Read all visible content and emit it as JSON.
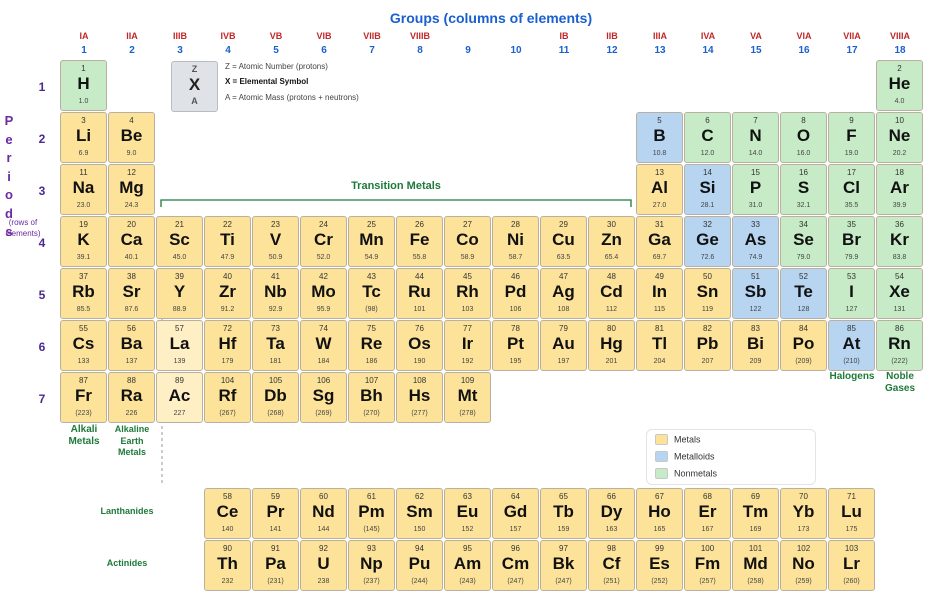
{
  "title": "Groups (columns of elements)",
  "group_labels": [
    "IA",
    "IIA",
    "IIIB",
    "IVB",
    "VB",
    "VIB",
    "VIIB",
    "VIIIB",
    "",
    "",
    "IB",
    "IIB",
    "IIIA",
    "IVA",
    "VA",
    "VIA",
    "VIIA",
    "VIIIA"
  ],
  "group_numbers": [
    "1",
    "2",
    "3",
    "4",
    "5",
    "6",
    "7",
    "8",
    "9",
    "10",
    "11",
    "12",
    "13",
    "14",
    "15",
    "16",
    "17",
    "18"
  ],
  "periods_label": "Periods",
  "periods_note": [
    "(rows of",
    "elements)"
  ],
  "period_numbers": [
    "1",
    "2",
    "3",
    "4",
    "5",
    "6",
    "7"
  ],
  "key": {
    "z": "Z",
    "x": "X",
    "a": "A",
    "lines": [
      "Z = Atomic Number (protons)",
      "X = Elemental Symbol",
      "A = Atomic Mass (protons + neutrons)"
    ]
  },
  "transition_label": "Transition Metals",
  "labels": {
    "alkali": [
      "Alkali",
      "Metals"
    ],
    "alkaline": [
      "Alkaline",
      "Earth",
      "Metals"
    ],
    "halogens": "Halogens",
    "noble": [
      "Noble",
      "Gases"
    ],
    "lanthanides": "Lanthanides",
    "actinides": "Actinides"
  },
  "legend": [
    {
      "label": "Metals",
      "color": "#fde39a"
    },
    {
      "label": "Metalloids",
      "color": "#b7d5f0"
    },
    {
      "label": "Nonmetals",
      "color": "#c6ebc6"
    }
  ],
  "elements": [
    {
      "z": "1",
      "s": "H",
      "m": "1.0",
      "g": 1,
      "p": 1,
      "c": "nonmetal"
    },
    {
      "z": "2",
      "s": "He",
      "m": "4.0",
      "g": 18,
      "p": 1,
      "c": "nonmetal"
    },
    {
      "z": "3",
      "s": "Li",
      "m": "6.9",
      "g": 1,
      "p": 2,
      "c": "metal"
    },
    {
      "z": "4",
      "s": "Be",
      "m": "9.0",
      "g": 2,
      "p": 2,
      "c": "metal"
    },
    {
      "z": "5",
      "s": "B",
      "m": "10.8",
      "g": 13,
      "p": 2,
      "c": "metalloid"
    },
    {
      "z": "6",
      "s": "C",
      "m": "12.0",
      "g": 14,
      "p": 2,
      "c": "nonmetal"
    },
    {
      "z": "7",
      "s": "N",
      "m": "14.0",
      "g": 15,
      "p": 2,
      "c": "nonmetal"
    },
    {
      "z": "8",
      "s": "O",
      "m": "16.0",
      "g": 16,
      "p": 2,
      "c": "nonmetal"
    },
    {
      "z": "9",
      "s": "F",
      "m": "19.0",
      "g": 17,
      "p": 2,
      "c": "nonmetal"
    },
    {
      "z": "10",
      "s": "Ne",
      "m": "20.2",
      "g": 18,
      "p": 2,
      "c": "nonmetal"
    },
    {
      "z": "11",
      "s": "Na",
      "m": "23.0",
      "g": 1,
      "p": 3,
      "c": "metal"
    },
    {
      "z": "12",
      "s": "Mg",
      "m": "24.3",
      "g": 2,
      "p": 3,
      "c": "metal"
    },
    {
      "z": "13",
      "s": "Al",
      "m": "27.0",
      "g": 13,
      "p": 3,
      "c": "metal"
    },
    {
      "z": "14",
      "s": "Si",
      "m": "28.1",
      "g": 14,
      "p": 3,
      "c": "metalloid"
    },
    {
      "z": "15",
      "s": "P",
      "m": "31.0",
      "g": 15,
      "p": 3,
      "c": "nonmetal"
    },
    {
      "z": "16",
      "s": "S",
      "m": "32.1",
      "g": 16,
      "p": 3,
      "c": "nonmetal"
    },
    {
      "z": "17",
      "s": "Cl",
      "m": "35.5",
      "g": 17,
      "p": 3,
      "c": "nonmetal"
    },
    {
      "z": "18",
      "s": "Ar",
      "m": "39.9",
      "g": 18,
      "p": 3,
      "c": "nonmetal"
    },
    {
      "z": "19",
      "s": "K",
      "m": "39.1",
      "g": 1,
      "p": 4,
      "c": "metal"
    },
    {
      "z": "20",
      "s": "Ca",
      "m": "40.1",
      "g": 2,
      "p": 4,
      "c": "metal"
    },
    {
      "z": "21",
      "s": "Sc",
      "m": "45.0",
      "g": 3,
      "p": 4,
      "c": "metal"
    },
    {
      "z": "22",
      "s": "Ti",
      "m": "47.9",
      "g": 4,
      "p": 4,
      "c": "metal"
    },
    {
      "z": "23",
      "s": "V",
      "m": "50.9",
      "g": 5,
      "p": 4,
      "c": "metal"
    },
    {
      "z": "24",
      "s": "Cr",
      "m": "52.0",
      "g": 6,
      "p": 4,
      "c": "metal"
    },
    {
      "z": "25",
      "s": "Mn",
      "m": "54.9",
      "g": 7,
      "p": 4,
      "c": "metal"
    },
    {
      "z": "26",
      "s": "Fe",
      "m": "55.8",
      "g": 8,
      "p": 4,
      "c": "metal"
    },
    {
      "z": "27",
      "s": "Co",
      "m": "58.9",
      "g": 9,
      "p": 4,
      "c": "metal"
    },
    {
      "z": "28",
      "s": "Ni",
      "m": "58.7",
      "g": 10,
      "p": 4,
      "c": "metal"
    },
    {
      "z": "29",
      "s": "Cu",
      "m": "63.5",
      "g": 11,
      "p": 4,
      "c": "metal"
    },
    {
      "z": "30",
      "s": "Zn",
      "m": "65.4",
      "g": 12,
      "p": 4,
      "c": "metal"
    },
    {
      "z": "31",
      "s": "Ga",
      "m": "69.7",
      "g": 13,
      "p": 4,
      "c": "metal"
    },
    {
      "z": "32",
      "s": "Ge",
      "m": "72.6",
      "g": 14,
      "p": 4,
      "c": "metalloid"
    },
    {
      "z": "33",
      "s": "As",
      "m": "74.9",
      "g": 15,
      "p": 4,
      "c": "metalloid"
    },
    {
      "z": "34",
      "s": "Se",
      "m": "79.0",
      "g": 16,
      "p": 4,
      "c": "nonmetal"
    },
    {
      "z": "35",
      "s": "Br",
      "m": "79.9",
      "g": 17,
      "p": 4,
      "c": "nonmetal"
    },
    {
      "z": "36",
      "s": "Kr",
      "m": "83.8",
      "g": 18,
      "p": 4,
      "c": "nonmetal"
    },
    {
      "z": "37",
      "s": "Rb",
      "m": "85.5",
      "g": 1,
      "p": 5,
      "c": "metal"
    },
    {
      "z": "38",
      "s": "Sr",
      "m": "87.6",
      "g": 2,
      "p": 5,
      "c": "metal"
    },
    {
      "z": "39",
      "s": "Y",
      "m": "88.9",
      "g": 3,
      "p": 5,
      "c": "metal"
    },
    {
      "z": "40",
      "s": "Zr",
      "m": "91.2",
      "g": 4,
      "p": 5,
      "c": "metal"
    },
    {
      "z": "41",
      "s": "Nb",
      "m": "92.9",
      "g": 5,
      "p": 5,
      "c": "metal"
    },
    {
      "z": "42",
      "s": "Mo",
      "m": "95.9",
      "g": 6,
      "p": 5,
      "c": "metal"
    },
    {
      "z": "43",
      "s": "Tc",
      "m": "(98)",
      "g": 7,
      "p": 5,
      "c": "metal"
    },
    {
      "z": "44",
      "s": "Ru",
      "m": "101",
      "g": 8,
      "p": 5,
      "c": "metal"
    },
    {
      "z": "45",
      "s": "Rh",
      "m": "103",
      "g": 9,
      "p": 5,
      "c": "metal"
    },
    {
      "z": "46",
      "s": "Pd",
      "m": "106",
      "g": 10,
      "p": 5,
      "c": "metal"
    },
    {
      "z": "47",
      "s": "Ag",
      "m": "108",
      "g": 11,
      "p": 5,
      "c": "metal"
    },
    {
      "z": "48",
      "s": "Cd",
      "m": "112",
      "g": 12,
      "p": 5,
      "c": "metal"
    },
    {
      "z": "49",
      "s": "In",
      "m": "115",
      "g": 13,
      "p": 5,
      "c": "metal"
    },
    {
      "z": "50",
      "s": "Sn",
      "m": "119",
      "g": 14,
      "p": 5,
      "c": "metal"
    },
    {
      "z": "51",
      "s": "Sb",
      "m": "122",
      "g": 15,
      "p": 5,
      "c": "metalloid"
    },
    {
      "z": "52",
      "s": "Te",
      "m": "128",
      "g": 16,
      "p": 5,
      "c": "metalloid"
    },
    {
      "z": "53",
      "s": "I",
      "m": "127",
      "g": 17,
      "p": 5,
      "c": "nonmetal"
    },
    {
      "z": "54",
      "s": "Xe",
      "m": "131",
      "g": 18,
      "p": 5,
      "c": "nonmetal"
    },
    {
      "z": "55",
      "s": "Cs",
      "m": "133",
      "g": 1,
      "p": 6,
      "c": "metal"
    },
    {
      "z": "56",
      "s": "Ba",
      "m": "137",
      "g": 2,
      "p": 6,
      "c": "metal"
    },
    {
      "z": "57",
      "s": "La",
      "m": "139",
      "g": 3,
      "p": 6,
      "c": "metal-light"
    },
    {
      "z": "72",
      "s": "Hf",
      "m": "179",
      "g": 4,
      "p": 6,
      "c": "metal"
    },
    {
      "z": "73",
      "s": "Ta",
      "m": "181",
      "g": 5,
      "p": 6,
      "c": "metal"
    },
    {
      "z": "74",
      "s": "W",
      "m": "184",
      "g": 6,
      "p": 6,
      "c": "metal"
    },
    {
      "z": "75",
      "s": "Re",
      "m": "186",
      "g": 7,
      "p": 6,
      "c": "metal"
    },
    {
      "z": "76",
      "s": "Os",
      "m": "190",
      "g": 8,
      "p": 6,
      "c": "metal"
    },
    {
      "z": "77",
      "s": "Ir",
      "m": "192",
      "g": 9,
      "p": 6,
      "c": "metal"
    },
    {
      "z": "78",
      "s": "Pt",
      "m": "195",
      "g": 10,
      "p": 6,
      "c": "metal"
    },
    {
      "z": "79",
      "s": "Au",
      "m": "197",
      "g": 11,
      "p": 6,
      "c": "metal"
    },
    {
      "z": "80",
      "s": "Hg",
      "m": "201",
      "g": 12,
      "p": 6,
      "c": "metal"
    },
    {
      "z": "81",
      "s": "Tl",
      "m": "204",
      "g": 13,
      "p": 6,
      "c": "metal"
    },
    {
      "z": "82",
      "s": "Pb",
      "m": "207",
      "g": 14,
      "p": 6,
      "c": "metal"
    },
    {
      "z": "83",
      "s": "Bi",
      "m": "209",
      "g": 15,
      "p": 6,
      "c": "metal"
    },
    {
      "z": "84",
      "s": "Po",
      "m": "(209)",
      "g": 16,
      "p": 6,
      "c": "metal"
    },
    {
      "z": "85",
      "s": "At",
      "m": "(210)",
      "g": 17,
      "p": 6,
      "c": "metalloid"
    },
    {
      "z": "86",
      "s": "Rn",
      "m": "(222)",
      "g": 18,
      "p": 6,
      "c": "nonmetal"
    },
    {
      "z": "87",
      "s": "Fr",
      "m": "(223)",
      "g": 1,
      "p": 7,
      "c": "metal"
    },
    {
      "z": "88",
      "s": "Ra",
      "m": "226",
      "g": 2,
      "p": 7,
      "c": "metal"
    },
    {
      "z": "89",
      "s": "Ac",
      "m": "227",
      "g": 3,
      "p": 7,
      "c": "metal-light"
    },
    {
      "z": "104",
      "s": "Rf",
      "m": "(267)",
      "g": 4,
      "p": 7,
      "c": "metal"
    },
    {
      "z": "105",
      "s": "Db",
      "m": "(268)",
      "g": 5,
      "p": 7,
      "c": "metal"
    },
    {
      "z": "106",
      "s": "Sg",
      "m": "(269)",
      "g": 6,
      "p": 7,
      "c": "metal"
    },
    {
      "z": "107",
      "s": "Bh",
      "m": "(270)",
      "g": 7,
      "p": 7,
      "c": "metal"
    },
    {
      "z": "108",
      "s": "Hs",
      "m": "(277)",
      "g": 8,
      "p": 7,
      "c": "metal"
    },
    {
      "z": "109",
      "s": "Mt",
      "m": "(278)",
      "g": 9,
      "p": 7,
      "c": "metal"
    },
    {
      "z": "58",
      "s": "Ce",
      "m": "140",
      "g": 4,
      "p": 9,
      "c": "metal"
    },
    {
      "z": "59",
      "s": "Pr",
      "m": "141",
      "g": 5,
      "p": 9,
      "c": "metal"
    },
    {
      "z": "60",
      "s": "Nd",
      "m": "144",
      "g": 6,
      "p": 9,
      "c": "metal"
    },
    {
      "z": "61",
      "s": "Pm",
      "m": "(145)",
      "g": 7,
      "p": 9,
      "c": "metal"
    },
    {
      "z": "62",
      "s": "Sm",
      "m": "150",
      "g": 8,
      "p": 9,
      "c": "metal"
    },
    {
      "z": "63",
      "s": "Eu",
      "m": "152",
      "g": 9,
      "p": 9,
      "c": "metal"
    },
    {
      "z": "64",
      "s": "Gd",
      "m": "157",
      "g": 10,
      "p": 9,
      "c": "metal"
    },
    {
      "z": "65",
      "s": "Tb",
      "m": "159",
      "g": 11,
      "p": 9,
      "c": "metal"
    },
    {
      "z": "66",
      "s": "Dy",
      "m": "163",
      "g": 12,
      "p": 9,
      "c": "metal"
    },
    {
      "z": "67",
      "s": "Ho",
      "m": "165",
      "g": 13,
      "p": 9,
      "c": "metal"
    },
    {
      "z": "68",
      "s": "Er",
      "m": "167",
      "g": 14,
      "p": 9,
      "c": "metal"
    },
    {
      "z": "69",
      "s": "Tm",
      "m": "169",
      "g": 15,
      "p": 9,
      "c": "metal"
    },
    {
      "z": "70",
      "s": "Yb",
      "m": "173",
      "g": 16,
      "p": 9,
      "c": "metal"
    },
    {
      "z": "71",
      "s": "Lu",
      "m": "175",
      "g": 17,
      "p": 9,
      "c": "metal"
    },
    {
      "z": "90",
      "s": "Th",
      "m": "232",
      "g": 4,
      "p": 10,
      "c": "metal"
    },
    {
      "z": "91",
      "s": "Pa",
      "m": "(231)",
      "g": 5,
      "p": 10,
      "c": "metal"
    },
    {
      "z": "92",
      "s": "U",
      "m": "238",
      "g": 6,
      "p": 10,
      "c": "metal"
    },
    {
      "z": "93",
      "s": "Np",
      "m": "(237)",
      "g": 7,
      "p": 10,
      "c": "metal"
    },
    {
      "z": "94",
      "s": "Pu",
      "m": "(244)",
      "g": 8,
      "p": 10,
      "c": "metal"
    },
    {
      "z": "95",
      "s": "Am",
      "m": "(243)",
      "g": 9,
      "p": 10,
      "c": "metal"
    },
    {
      "z": "96",
      "s": "Cm",
      "m": "(247)",
      "g": 10,
      "p": 10,
      "c": "metal"
    },
    {
      "z": "97",
      "s": "Bk",
      "m": "(247)",
      "g": 11,
      "p": 10,
      "c": "metal"
    },
    {
      "z": "98",
      "s": "Cf",
      "m": "(251)",
      "g": 12,
      "p": 10,
      "c": "metal"
    },
    {
      "z": "99",
      "s": "Es",
      "m": "(252)",
      "g": 13,
      "p": 10,
      "c": "metal"
    },
    {
      "z": "100",
      "s": "Fm",
      "m": "(257)",
      "g": 14,
      "p": 10,
      "c": "metal"
    },
    {
      "z": "101",
      "s": "Md",
      "m": "(258)",
      "g": 15,
      "p": 10,
      "c": "metal"
    },
    {
      "z": "102",
      "s": "No",
      "m": "(259)",
      "g": 16,
      "p": 10,
      "c": "metal"
    },
    {
      "z": "103",
      "s": "Lr",
      "m": "(260)",
      "g": 17,
      "p": 10,
      "c": "metal"
    }
  ]
}
